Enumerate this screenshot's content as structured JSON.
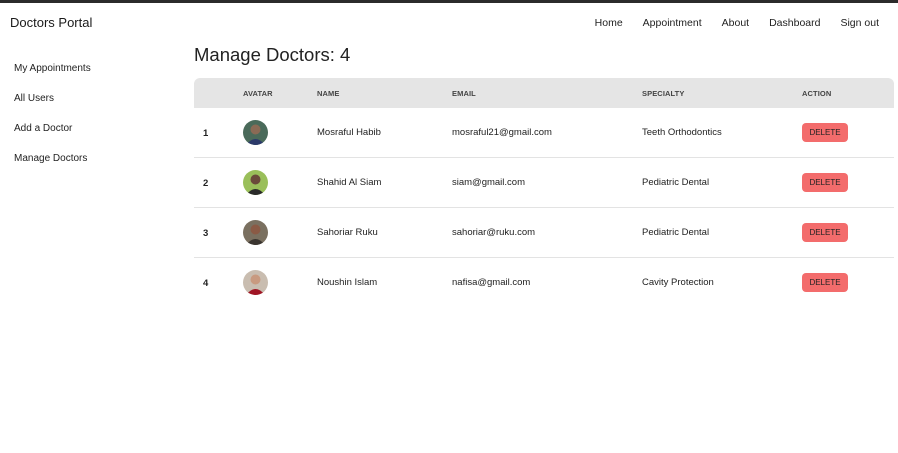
{
  "navbar": {
    "brand": "Doctors Portal",
    "links": [
      "Home",
      "Appointment",
      "About",
      "Dashboard",
      "Sign out"
    ]
  },
  "sidebar": {
    "items": [
      "My Appointments",
      "All Users",
      "Add a Doctor",
      "Manage Doctors"
    ]
  },
  "main": {
    "title": "Manage Doctors: 4",
    "columns": [
      "",
      "AVATAR",
      "NAME",
      "EMAIL",
      "SPECIALTY",
      "ACTION"
    ],
    "rows": [
      {
        "index": "1",
        "name": "Mosraful Habib",
        "email": "mosraful21@gmail.com",
        "specialty": "Teeth Orthodontics",
        "action": "DELETE"
      },
      {
        "index": "2",
        "name": "Shahid Al Siam",
        "email": "siam@gmail.com",
        "specialty": "Pediatric Dental",
        "action": "DELETE"
      },
      {
        "index": "3",
        "name": "Sahoriar Ruku",
        "email": "sahoriar@ruku.com",
        "specialty": "Pediatric Dental",
        "action": "DELETE"
      },
      {
        "index": "4",
        "name": "Noushin Islam",
        "email": "nafisa@gmail.com",
        "specialty": "Cavity Protection",
        "action": "DELETE"
      }
    ]
  },
  "colors": {
    "accent_delete": "#f36c6c",
    "table_header": "#e5e5e5",
    "top_strip": "#2b2b2b"
  }
}
